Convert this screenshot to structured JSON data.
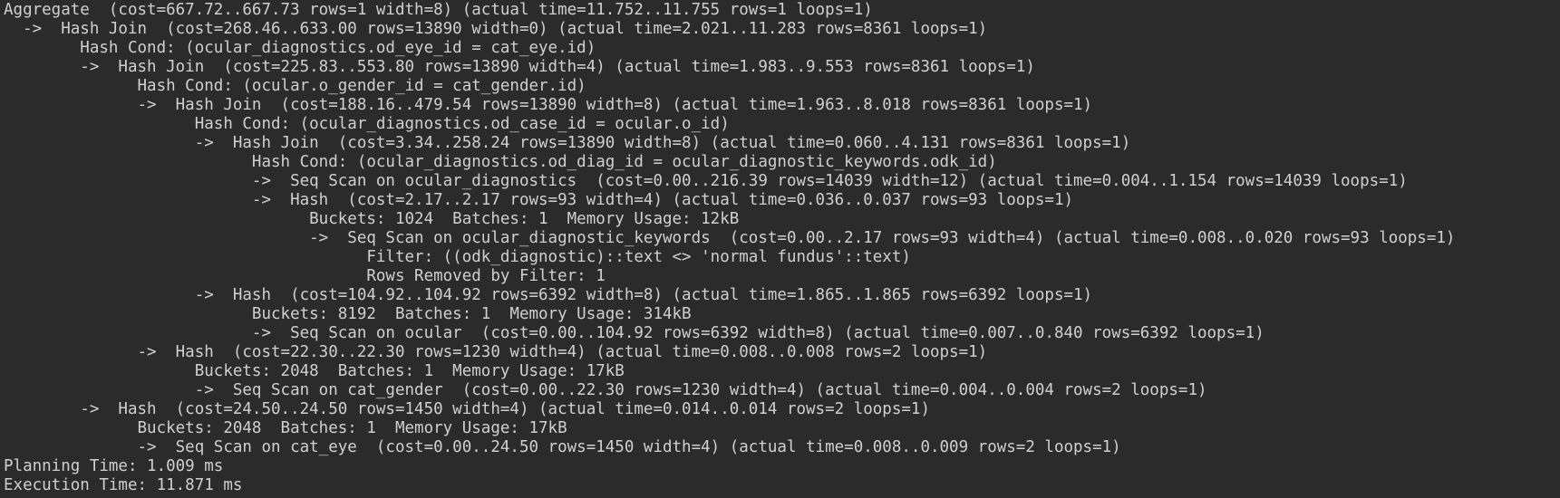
{
  "terminal": {
    "lines": [
      "Aggregate  (cost=667.72..667.73 rows=1 width=8) (actual time=11.752..11.755 rows=1 loops=1)",
      "  ->  Hash Join  (cost=268.46..633.00 rows=13890 width=0) (actual time=2.021..11.283 rows=8361 loops=1)",
      "        Hash Cond: (ocular_diagnostics.od_eye_id = cat_eye.id)",
      "        ->  Hash Join  (cost=225.83..553.80 rows=13890 width=4) (actual time=1.983..9.553 rows=8361 loops=1)",
      "              Hash Cond: (ocular.o_gender_id = cat_gender.id)",
      "              ->  Hash Join  (cost=188.16..479.54 rows=13890 width=8) (actual time=1.963..8.018 rows=8361 loops=1)",
      "                    Hash Cond: (ocular_diagnostics.od_case_id = ocular.o_id)",
      "                    ->  Hash Join  (cost=3.34..258.24 rows=13890 width=8) (actual time=0.060..4.131 rows=8361 loops=1)",
      "                          Hash Cond: (ocular_diagnostics.od_diag_id = ocular_diagnostic_keywords.odk_id)",
      "                          ->  Seq Scan on ocular_diagnostics  (cost=0.00..216.39 rows=14039 width=12) (actual time=0.004..1.154 rows=14039 loops=1)",
      "                          ->  Hash  (cost=2.17..2.17 rows=93 width=4) (actual time=0.036..0.037 rows=93 loops=1)",
      "                                Buckets: 1024  Batches: 1  Memory Usage: 12kB",
      "                                ->  Seq Scan on ocular_diagnostic_keywords  (cost=0.00..2.17 rows=93 width=4) (actual time=0.008..0.020 rows=93 loops=1)",
      "                                      Filter: ((odk_diagnostic)::text <> 'normal fundus'::text)",
      "                                      Rows Removed by Filter: 1",
      "                    ->  Hash  (cost=104.92..104.92 rows=6392 width=8) (actual time=1.865..1.865 rows=6392 loops=1)",
      "                          Buckets: 8192  Batches: 1  Memory Usage: 314kB",
      "                          ->  Seq Scan on ocular  (cost=0.00..104.92 rows=6392 width=8) (actual time=0.007..0.840 rows=6392 loops=1)",
      "              ->  Hash  (cost=22.30..22.30 rows=1230 width=4) (actual time=0.008..0.008 rows=2 loops=1)",
      "                    Buckets: 2048  Batches: 1  Memory Usage: 17kB",
      "                    ->  Seq Scan on cat_gender  (cost=0.00..22.30 rows=1230 width=4) (actual time=0.004..0.004 rows=2 loops=1)",
      "        ->  Hash  (cost=24.50..24.50 rows=1450 width=4) (actual time=0.014..0.014 rows=2 loops=1)",
      "              Buckets: 2048  Batches: 1  Memory Usage: 17kB",
      "              ->  Seq Scan on cat_eye  (cost=0.00..24.50 rows=1450 width=4) (actual time=0.008..0.009 rows=2 loops=1)",
      "Planning Time: 1.009 ms",
      "Execution Time: 11.871 ms"
    ]
  },
  "colors": {
    "background": "#2b2b2b",
    "text": "#d0d0d0"
  }
}
